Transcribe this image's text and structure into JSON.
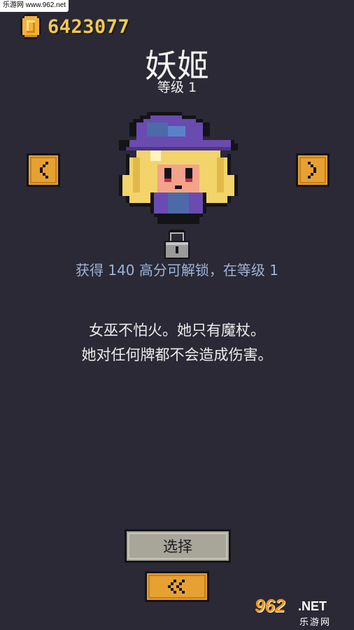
{
  "watermark": "乐游网 www.962.net",
  "coins": {
    "count": "6423077"
  },
  "character": {
    "name": "妖姬",
    "level": "等级 1",
    "unlock_text": "获得 140 高分可解锁，在等级 1",
    "description_line1": "女巫不怕火。她只有魔杖。",
    "description_line2": "她对任何牌都不会造成伤害。"
  },
  "buttons": {
    "select_label": "选择"
  },
  "logo": {
    "number": "962",
    "net": ".NET",
    "sub": "乐游网"
  },
  "colors": {
    "background": "#2a2935",
    "accent": "#e7a132",
    "coin_text": "#f2c94c",
    "unlock_text": "#9fb3d6"
  },
  "icons": [
    "coin-icon",
    "chevron-left-icon",
    "chevron-right-icon",
    "lock-icon",
    "double-chevron-left-icon"
  ]
}
